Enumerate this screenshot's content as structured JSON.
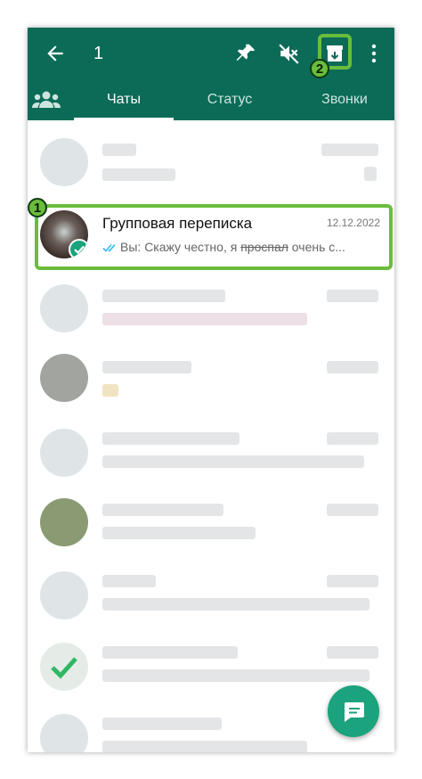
{
  "toolbar": {
    "selected_count": "1",
    "icons": [
      "back-arrow-icon",
      "pin-icon",
      "mute-icon",
      "archive-icon",
      "more-vert-icon"
    ]
  },
  "tabs": [
    {
      "label": "Чаты",
      "active": true
    },
    {
      "label": "Статус",
      "active": false
    },
    {
      "label": "Звонки",
      "active": false
    }
  ],
  "markers": {
    "chat": "1",
    "archive": "2"
  },
  "selected_chat": {
    "name": "Групповая переписка",
    "date": "12.12.2022",
    "preview_sender": "Вы: ",
    "preview_text_1": "Скажу честно, я ",
    "preview_strike": "проспал",
    "preview_text_2": " очень с..."
  },
  "colors": {
    "appbar": "#0b6b57",
    "highlight": "#6abd3c",
    "fab": "#1aa37d",
    "read_ticks": "#34b7f1"
  }
}
